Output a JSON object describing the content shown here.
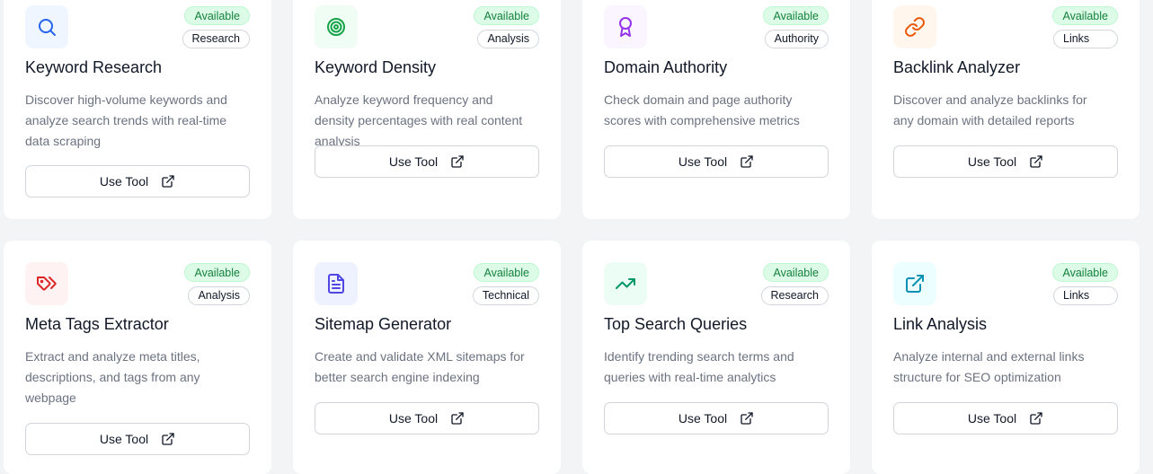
{
  "tools": [
    {
      "title": "Keyword Research",
      "status": "Available",
      "category": "Research",
      "description": "Discover high-volume keywords and analyze search trends with real-time data scraping",
      "button": "Use Tool",
      "icon": "search-icon",
      "color": "#2563eb",
      "bg": "#eff6ff"
    },
    {
      "title": "Keyword Density",
      "status": "Available",
      "category": "Analysis",
      "description": "Analyze keyword frequency and density percentages with real content analysis",
      "button": "Use Tool",
      "icon": "target-icon",
      "color": "#16a34a",
      "bg": "#f0fdf4"
    },
    {
      "title": "Domain Authority",
      "status": "Available",
      "category": "Authority",
      "description": "Check domain and page authority scores with comprehensive metrics",
      "button": "Use Tool",
      "icon": "award-icon",
      "color": "#9333ea",
      "bg": "#faf5ff"
    },
    {
      "title": "Backlink Analyzer",
      "status": "Available",
      "category": "Links",
      "description": "Discover and analyze backlinks for any domain with detailed reports",
      "button": "Use Tool",
      "icon": "link-icon",
      "color": "#ea580c",
      "bg": "#fff7ed"
    },
    {
      "title": "Meta Tags Extractor",
      "status": "Available",
      "category": "Analysis",
      "description": "Extract and analyze meta titles, descriptions, and tags from any webpage",
      "button": "Use Tool",
      "icon": "tags-icon",
      "color": "#dc2626",
      "bg": "#fef2f2"
    },
    {
      "title": "Sitemap Generator",
      "status": "Available",
      "category": "Technical",
      "description": "Create and validate XML sitemaps for better search engine indexing",
      "button": "Use Tool",
      "icon": "file-text-icon",
      "color": "#4f46e5",
      "bg": "#eef2ff"
    },
    {
      "title": "Top Search Queries",
      "status": "Available",
      "category": "Research",
      "description": "Identify trending search terms and queries with real-time analytics",
      "button": "Use Tool",
      "icon": "trending-up-icon",
      "color": "#059669",
      "bg": "#ecfdf5"
    },
    {
      "title": "Link Analysis",
      "status": "Available",
      "category": "Links",
      "description": "Analyze internal and external links structure for SEO optimization",
      "button": "Use Tool",
      "icon": "external-link-icon",
      "color": "#0891b2",
      "bg": "#ecfeff"
    }
  ]
}
